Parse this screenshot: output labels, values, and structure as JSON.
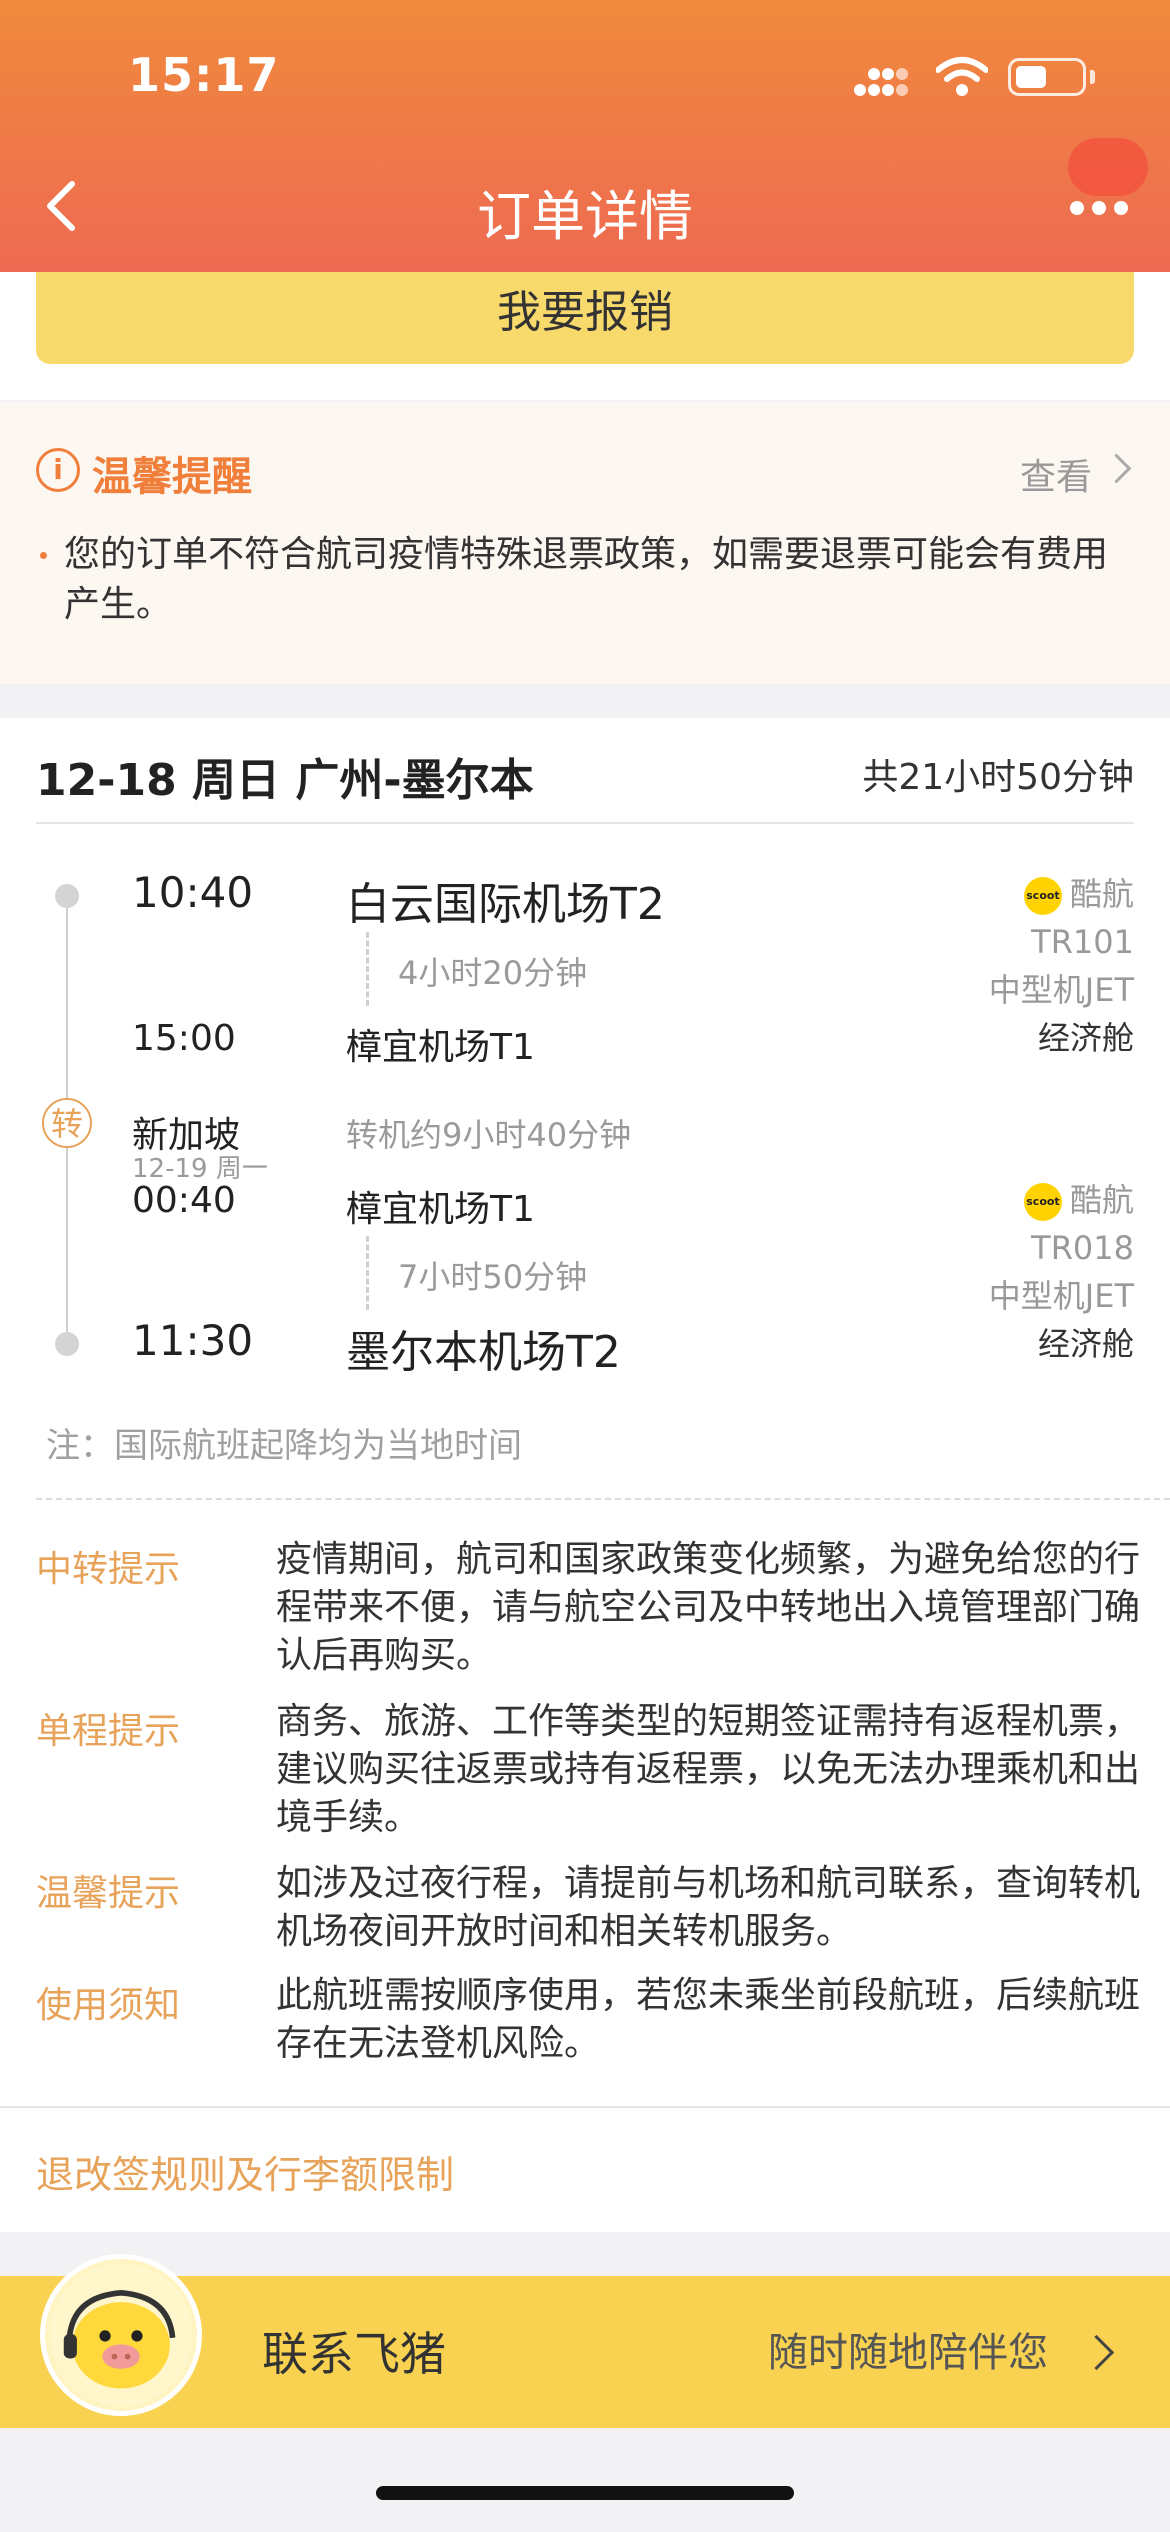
{
  "status_bar": {
    "time": "15:17"
  },
  "header": {
    "title": "订单详情"
  },
  "reimburse": {
    "label": "我要报销"
  },
  "warm_tip": {
    "title": "温馨提醒",
    "view_label": "查看",
    "text": "您的订单不符合航司疫情特殊退票政策，如需要退票可能会有费用产生。"
  },
  "route": {
    "title": "12-18 周日 广州-墨尔本",
    "total_duration": "共21小时50分钟"
  },
  "segments": [
    {
      "dep_time": "10:40",
      "dep_airport": "白云国际机场T2",
      "duration": "4小时20分钟",
      "arr_time": "15:00",
      "arr_airport": "樟宜机场T1",
      "airline": "酷航",
      "logo_text": "scoot",
      "flight_no": "TR101",
      "aircraft": "中型机JET",
      "cabin": "经济舱"
    },
    {
      "dep_time": "00:40",
      "dep_airport": "樟宜机场T1",
      "duration": "7小时50分钟",
      "arr_time": "11:30",
      "arr_airport": "墨尔本机场T2",
      "airline": "酷航",
      "logo_text": "scoot",
      "flight_no": "TR018",
      "aircraft": "中型机JET",
      "cabin": "经济舱"
    }
  ],
  "transfer": {
    "icon_label": "转",
    "city": "新加坡",
    "date": "12-19 周一",
    "duration": "转机约9小时40分钟"
  },
  "note": "注：国际航班起降均为当地时间",
  "tips": [
    {
      "label": "中转提示",
      "text": "疫情期间，航司和国家政策变化频繁，为避免给您的行程带来不便，请与航空公司及中转地出入境管理部门确认后再购买。"
    },
    {
      "label": "单程提示",
      "text": "商务、旅游、工作等类型的短期签证需持有返程机票，建议购买往返票或持有返程票，以免无法办理乘机和出境手续。"
    },
    {
      "label": "温馨提示",
      "text": "如涉及过夜行程，请提前与机场和航司联系，查询转机机场夜间开放时间和相关转机服务。"
    },
    {
      "label": "使用须知",
      "text": "此航班需按顺序使用，若您未乘坐前段航班，后续航班存在无法登机风险。"
    }
  ],
  "rules_link": "退改签规则及行李额限制",
  "contact": {
    "title": "联系飞猪",
    "subtitle": "随时随地陪伴您"
  },
  "colors": {
    "header_start": "#f08a3c",
    "header_end": "#ee6a52",
    "accent": "#e8a35a",
    "reimburse_bg": "#f8d96c",
    "contact_bg": "#f8d250"
  }
}
